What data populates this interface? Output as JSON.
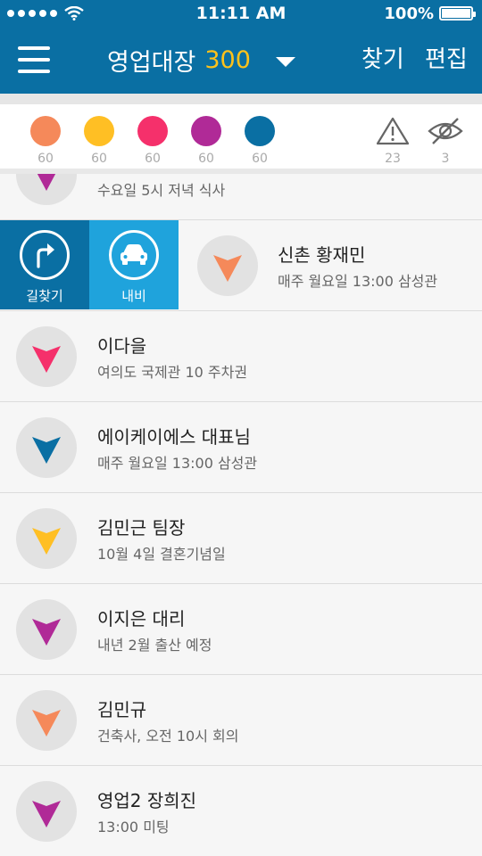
{
  "status": {
    "time": "11:11 AM",
    "battery": "100%"
  },
  "nav": {
    "title": "영업대장",
    "count": "300",
    "find_label": "찾기",
    "edit_label": "편집"
  },
  "filters": {
    "colors": [
      {
        "color": "#f5895a",
        "count": "60"
      },
      {
        "color": "#ffbf24",
        "count": "60"
      },
      {
        "color": "#f5306b",
        "count": "60"
      },
      {
        "color": "#b02a97",
        "count": "60"
      },
      {
        "color": "#0a6fa3",
        "count": "60"
      }
    ],
    "alert_count": "23",
    "hidden_count": "3"
  },
  "swipe_actions": {
    "directions_label": "길찾기",
    "navi_label": "내비"
  },
  "list": [
    {
      "title": "",
      "subtitle": "수요일 5시 저녁 식사",
      "color": "#b02a97"
    },
    {
      "title": "신촌 황재민",
      "subtitle": "매주 월요일 13:00 삼성관",
      "color": "#f5895a"
    },
    {
      "title": "이다을",
      "subtitle": "여의도 국제관 10 주차권",
      "color": "#f5306b"
    },
    {
      "title": "에이케이에스 대표님",
      "subtitle": "매주 월요일 13:00 삼성관",
      "color": "#0a6fa3"
    },
    {
      "title": "김민근 팀장",
      "subtitle": "10월 4일 결혼기념일",
      "color": "#ffbf24"
    },
    {
      "title": "이지은 대리",
      "subtitle": "내년 2월 출산 예정",
      "color": "#b02a97"
    },
    {
      "title": "김민규",
      "subtitle": "건축사, 오전 10시 회의",
      "color": "#f5895a"
    },
    {
      "title": "영업2 장희진",
      "subtitle": "13:00 미팅",
      "color": "#b02a97"
    }
  ]
}
